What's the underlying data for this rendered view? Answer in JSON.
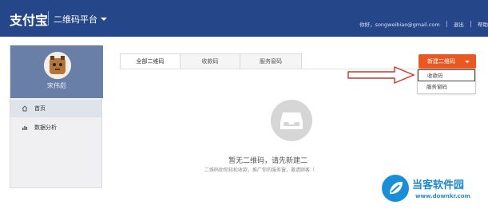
{
  "header": {
    "logo_text": "支付宝",
    "platform_name": "二维码平台",
    "greeting": "你好，songweibiao@gmail.com",
    "logout_label": "退出",
    "help_label": "帮助"
  },
  "sidebar": {
    "username": "宋伟彪",
    "items": [
      {
        "label": "首页",
        "icon": "home-icon",
        "active": true
      },
      {
        "label": "数据分析",
        "icon": "chart-icon",
        "active": false
      }
    ]
  },
  "main": {
    "tabs": [
      {
        "label": "全部二维码",
        "active": true
      },
      {
        "label": "收款码",
        "active": false
      },
      {
        "label": "服务窗码",
        "active": false
      }
    ],
    "new_button_label": "新建二维码",
    "dropdown_items": [
      {
        "label": "收款码",
        "highlighted": true
      },
      {
        "label": "服务窗码",
        "highlighted": false
      }
    ],
    "empty_title": "暂无二维码，请先新建二",
    "empty_desc": "二维码助你轻松收款，推广你的服务窗，邀请顾客（"
  },
  "watermark": {
    "title": "当客软件园",
    "url": "www.downkr.com"
  },
  "colors": {
    "header_bg": "#25478a",
    "accent_orange": "#ea5822",
    "sidebar_profile_bg": "#6a7fa8",
    "watermark_blue": "#1a8fd8",
    "annotation_red": "#d2322b"
  }
}
